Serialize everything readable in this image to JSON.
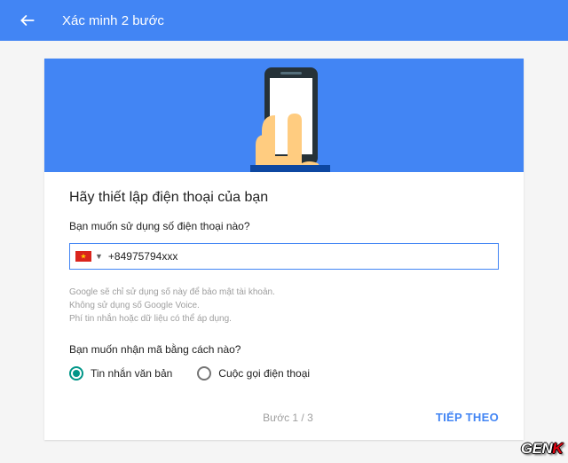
{
  "topbar": {
    "title": "Xác minh 2 bước"
  },
  "card": {
    "heading": "Hãy thiết lập điện thoại của bạn",
    "phone_question": "Bạn muốn sử dụng số điện thoại nào?",
    "phone_value": "+84975794xxx",
    "hint_line1": "Google sẽ chỉ sử dụng số này để bảo mật tài khoản.",
    "hint_line2": "Không sử dụng số Google Voice.",
    "hint_line3": "Phí tin nhắn hoặc dữ liệu có thể áp dụng.",
    "method_question": "Bạn muốn nhận mã bằng cách nào?",
    "radio_sms": "Tin nhắn văn bản",
    "radio_call": "Cuộc gọi điện thoại",
    "selected_method": "sms"
  },
  "footer": {
    "step": "Bước 1 / 3",
    "next": "TIẾP THEO"
  },
  "watermark": {
    "prefix": "GEN",
    "suffix": "K"
  }
}
